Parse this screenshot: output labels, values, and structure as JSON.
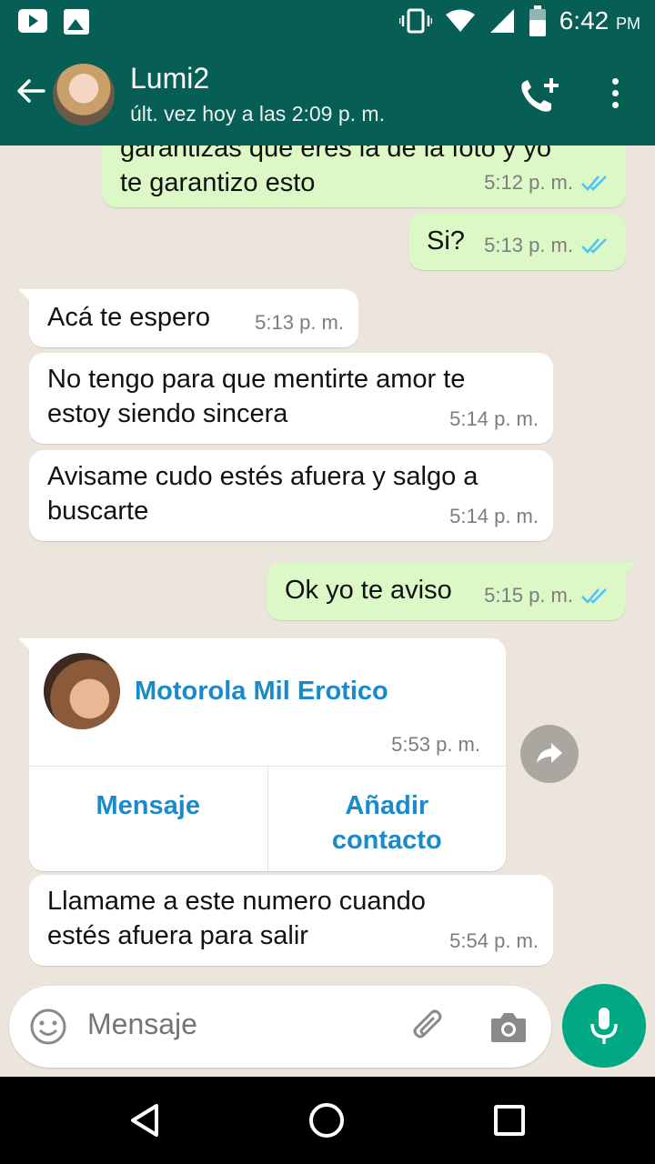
{
  "status_bar": {
    "time": "6:42",
    "ampm": "PM",
    "icons": [
      "youtube-icon",
      "gallery-icon",
      "vibrate-icon",
      "wifi-icon",
      "signal-icon",
      "battery-icon"
    ]
  },
  "header": {
    "contact_name": "Lumi2",
    "last_seen": "últ. vez hoy a las 2:09 p. m.",
    "icons": [
      "back-arrow-icon",
      "add-call-icon",
      "more-vert-icon"
    ]
  },
  "messages": [
    {
      "direction": "out",
      "text_line1": "garantizas que eres la de la foto y yo",
      "text_line2": "te garantizo esto",
      "time": "5:12 p. m.",
      "status": "read"
    },
    {
      "direction": "out",
      "text": "Si?",
      "time": "5:13 p. m.",
      "status": "read"
    },
    {
      "direction": "in",
      "text": "Acá te espero",
      "time": "5:13 p. m."
    },
    {
      "direction": "in",
      "text_line1": "No tengo para que mentirte amor te",
      "text_line2": "estoy siendo sincera",
      "time": "5:14 p. m."
    },
    {
      "direction": "in",
      "text_line1": "Avisame cudo estés afuera y salgo a",
      "text_line2": "buscarte",
      "time": "5:14 p. m."
    },
    {
      "direction": "out",
      "text": "Ok yo te aviso",
      "time": "5:15 p. m.",
      "status": "read"
    },
    {
      "direction": "in",
      "text_line1": "Llamame a este numero cuando",
      "text_line2": "estés afuera para salir",
      "time": "5:54 p. m."
    }
  ],
  "contact_card": {
    "name": "Motorola Mil Erotico",
    "time": "5:53 p. m.",
    "message_button": "Mensaje",
    "add_button_line1": "Añadir",
    "add_button_line2": "contacto"
  },
  "input": {
    "placeholder": "Mensaje",
    "icons": [
      "emoji-icon",
      "attach-icon",
      "camera-icon",
      "mic-icon"
    ]
  },
  "colors": {
    "header": "#075E54",
    "outgoing_bubble": "#DCF8C6",
    "incoming_bubble": "#FFFFFF",
    "read_ticks": "#4FC3F7",
    "accent": "#00A884",
    "link": "#1A8ACB",
    "chat_bg": "#ECE5DD"
  }
}
